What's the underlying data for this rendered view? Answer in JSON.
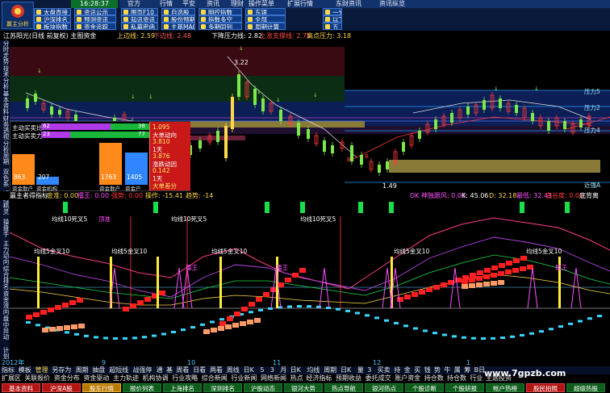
{
  "clock": "16:28:37",
  "menu": [
    "官方",
    "行情",
    "平安",
    "资讯",
    "理财",
    "操作菜单",
    "扩展行情",
    "东财资讯",
    "资讯纵览"
  ],
  "toolbar": {
    "logo_text": "赢主分析",
    "row1": [
      "大盘直接",
      "资讯公示",
      "图页F10",
      "自选股",
      "明控指数",
      "东银",
      "一分"
    ],
    "row2": [
      "沪深排名",
      "预测资讯",
      "知讯资讯",
      "股份预期",
      "指数多空",
      "全部",
      "以下"
    ],
    "row3": [
      "板块指数",
      "资金追踪",
      "私募密函",
      "主基MACD",
      "多期同列",
      "周期计算",
      "五"
    ]
  },
  "chart_header": {
    "stock": "江苏阳光(日线 前复权) 主图资金",
    "upper_label": "上边线: 2.59",
    "lower_label": "下边线: 2.48",
    "down_pressure": "下降压力线: 2.82",
    "up_support": "上涨支撑线: 2.75",
    "high_point": "高点压力: 3.18"
  },
  "side_nav": [
    "分时走势",
    "技术分析",
    "基本资料",
    "财务透视",
    "分析周期",
    "双色系",
    "短线精灵",
    "操盘手",
    "主力动向",
    "综合排名",
    "资金流向",
    "盘中异动",
    "计划"
  ],
  "main_chart": {
    "price_marker": "3.22",
    "low_marker": "1.49",
    "right_labels": [
      "压力5",
      "压力2",
      "压力4",
      "近强A"
    ]
  },
  "info_box": {
    "row1_label": "主动买卖比",
    "row1_v1": "62",
    "row1_v2": "38",
    "row2_label": "主动买卖力",
    "row2_v1": "23",
    "row2_v2": "77",
    "bars": [
      {
        "label": "资金散户",
        "value": "863",
        "color": "#ff8a1c"
      },
      {
        "label": "资金机构",
        "value": "207",
        "color": "#2f86ff"
      },
      {
        "label": "资金散户",
        "value": "1763",
        "color": "#ff8a1c"
      },
      {
        "label": "资金户",
        "value": "1405",
        "color": "#2f86ff"
      }
    ],
    "right_values": [
      "1.095",
      "大单动向",
      "3.810",
      "1天",
      "3.876",
      "涨跌动因",
      "0.142",
      "1天",
      "大单差分"
    ]
  },
  "lower_header": {
    "title": "赢主者得指标",
    "gold": "金准: 0.00",
    "dark": "擂王: 0.00",
    "strong": "强势: 0.00",
    "op": "操作: -15.41",
    "trend": "趋势: -14",
    "dk": "DK 神独跟风: 0.00",
    "k": "K: 45.06",
    "d": "D: 32.18",
    "top": "最低: 32.43",
    "valley": "底谷度: 0.00",
    "level": "底背离"
  },
  "lower_chart": {
    "labels": [
      "均线10死叉5",
      "顶准",
      "均线10死叉5",
      "均线10死叉5",
      "均线5金叉10",
      "均线5金叉10",
      "均线5金叉10",
      "均线5金叉10",
      "擂王",
      "擂王",
      "擂王",
      "均线5金叉10"
    ]
  },
  "bottom_date": [
    "2012年",
    "9",
    "10",
    "11",
    "12",
    "1"
  ],
  "bottom_tabs": [
    "指标",
    "模板",
    "管理",
    "另存为",
    "周期",
    "抽盘",
    "超短线",
    "战强停",
    "通",
    "基",
    "周看",
    "日看",
    "两看",
    "周线",
    "日K",
    "5",
    "3",
    "月",
    "日K",
    "均线",
    "周期",
    "日K",
    "量",
    "3",
    "买卖",
    "持",
    "金",
    "买",
    "钱",
    "势",
    "牛",
    "属",
    "筹",
    "B日"
  ],
  "bottom_tabs2": [
    "扩展区",
    "关联报价",
    "资金分布",
    "资金驱动",
    "主力轨迹",
    "机构协调",
    "行业攻略",
    "综合新闻",
    "行业新闻",
    "网络新闻",
    "热点",
    "经济指标",
    "预期收益",
    "委托成交",
    "账户资金",
    "持仓数",
    "持仓数",
    "行业",
    "主题投资"
  ],
  "bottom_buttons": [
    {
      "label": "基本资料",
      "style": "r"
    },
    {
      "label": "沪深A股",
      "style": "r"
    },
    {
      "label": "股东行情",
      "style": "y"
    },
    {
      "label": "报价列表",
      "style": "g"
    },
    {
      "label": "上海排名",
      "style": "g"
    },
    {
      "label": "深圳排名",
      "style": "g"
    },
    {
      "label": "沪股动态",
      "style": "g"
    },
    {
      "label": "银河大势",
      "style": "g"
    },
    {
      "label": "热点导航",
      "style": "g"
    },
    {
      "label": "银河热点",
      "style": "g"
    },
    {
      "label": "个股诊断",
      "style": "g"
    },
    {
      "label": "个股研报",
      "style": "g"
    },
    {
      "label": "帐户热榜",
      "style": "g"
    },
    {
      "label": "股民拍照",
      "style": "r"
    },
    {
      "label": "超级热股",
      "style": "g"
    }
  ],
  "watermark": "www.7gpzb.com"
}
